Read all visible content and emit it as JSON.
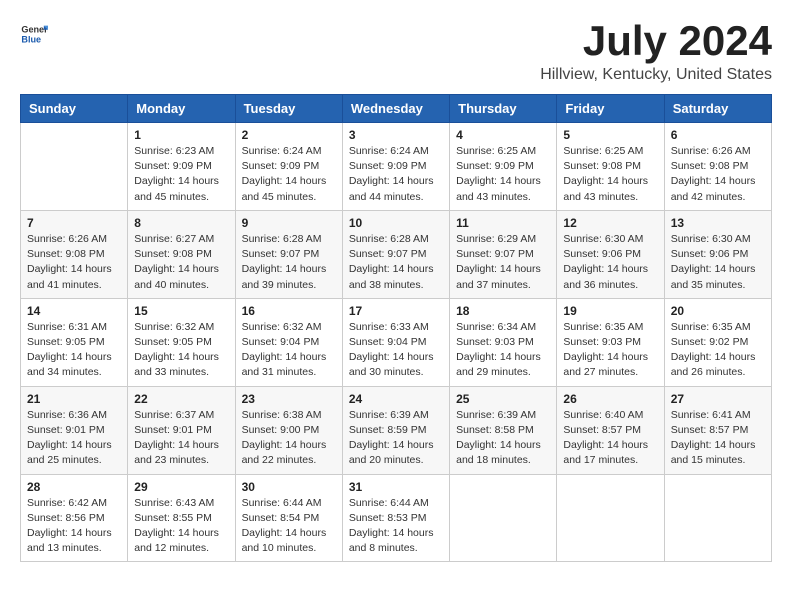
{
  "header": {
    "logo_general": "General",
    "logo_blue": "Blue",
    "title": "July 2024",
    "subtitle": "Hillview, Kentucky, United States"
  },
  "columns": [
    "Sunday",
    "Monday",
    "Tuesday",
    "Wednesday",
    "Thursday",
    "Friday",
    "Saturday"
  ],
  "weeks": [
    [
      {
        "day": "",
        "sunrise": "",
        "sunset": "",
        "daylight": ""
      },
      {
        "day": "1",
        "sunrise": "Sunrise: 6:23 AM",
        "sunset": "Sunset: 9:09 PM",
        "daylight": "Daylight: 14 hours and 45 minutes."
      },
      {
        "day": "2",
        "sunrise": "Sunrise: 6:24 AM",
        "sunset": "Sunset: 9:09 PM",
        "daylight": "Daylight: 14 hours and 45 minutes."
      },
      {
        "day": "3",
        "sunrise": "Sunrise: 6:24 AM",
        "sunset": "Sunset: 9:09 PM",
        "daylight": "Daylight: 14 hours and 44 minutes."
      },
      {
        "day": "4",
        "sunrise": "Sunrise: 6:25 AM",
        "sunset": "Sunset: 9:09 PM",
        "daylight": "Daylight: 14 hours and 43 minutes."
      },
      {
        "day": "5",
        "sunrise": "Sunrise: 6:25 AM",
        "sunset": "Sunset: 9:08 PM",
        "daylight": "Daylight: 14 hours and 43 minutes."
      },
      {
        "day": "6",
        "sunrise": "Sunrise: 6:26 AM",
        "sunset": "Sunset: 9:08 PM",
        "daylight": "Daylight: 14 hours and 42 minutes."
      }
    ],
    [
      {
        "day": "7",
        "sunrise": "Sunrise: 6:26 AM",
        "sunset": "Sunset: 9:08 PM",
        "daylight": "Daylight: 14 hours and 41 minutes."
      },
      {
        "day": "8",
        "sunrise": "Sunrise: 6:27 AM",
        "sunset": "Sunset: 9:08 PM",
        "daylight": "Daylight: 14 hours and 40 minutes."
      },
      {
        "day": "9",
        "sunrise": "Sunrise: 6:28 AM",
        "sunset": "Sunset: 9:07 PM",
        "daylight": "Daylight: 14 hours and 39 minutes."
      },
      {
        "day": "10",
        "sunrise": "Sunrise: 6:28 AM",
        "sunset": "Sunset: 9:07 PM",
        "daylight": "Daylight: 14 hours and 38 minutes."
      },
      {
        "day": "11",
        "sunrise": "Sunrise: 6:29 AM",
        "sunset": "Sunset: 9:07 PM",
        "daylight": "Daylight: 14 hours and 37 minutes."
      },
      {
        "day": "12",
        "sunrise": "Sunrise: 6:30 AM",
        "sunset": "Sunset: 9:06 PM",
        "daylight": "Daylight: 14 hours and 36 minutes."
      },
      {
        "day": "13",
        "sunrise": "Sunrise: 6:30 AM",
        "sunset": "Sunset: 9:06 PM",
        "daylight": "Daylight: 14 hours and 35 minutes."
      }
    ],
    [
      {
        "day": "14",
        "sunrise": "Sunrise: 6:31 AM",
        "sunset": "Sunset: 9:05 PM",
        "daylight": "Daylight: 14 hours and 34 minutes."
      },
      {
        "day": "15",
        "sunrise": "Sunrise: 6:32 AM",
        "sunset": "Sunset: 9:05 PM",
        "daylight": "Daylight: 14 hours and 33 minutes."
      },
      {
        "day": "16",
        "sunrise": "Sunrise: 6:32 AM",
        "sunset": "Sunset: 9:04 PM",
        "daylight": "Daylight: 14 hours and 31 minutes."
      },
      {
        "day": "17",
        "sunrise": "Sunrise: 6:33 AM",
        "sunset": "Sunset: 9:04 PM",
        "daylight": "Daylight: 14 hours and 30 minutes."
      },
      {
        "day": "18",
        "sunrise": "Sunrise: 6:34 AM",
        "sunset": "Sunset: 9:03 PM",
        "daylight": "Daylight: 14 hours and 29 minutes."
      },
      {
        "day": "19",
        "sunrise": "Sunrise: 6:35 AM",
        "sunset": "Sunset: 9:03 PM",
        "daylight": "Daylight: 14 hours and 27 minutes."
      },
      {
        "day": "20",
        "sunrise": "Sunrise: 6:35 AM",
        "sunset": "Sunset: 9:02 PM",
        "daylight": "Daylight: 14 hours and 26 minutes."
      }
    ],
    [
      {
        "day": "21",
        "sunrise": "Sunrise: 6:36 AM",
        "sunset": "Sunset: 9:01 PM",
        "daylight": "Daylight: 14 hours and 25 minutes."
      },
      {
        "day": "22",
        "sunrise": "Sunrise: 6:37 AM",
        "sunset": "Sunset: 9:01 PM",
        "daylight": "Daylight: 14 hours and 23 minutes."
      },
      {
        "day": "23",
        "sunrise": "Sunrise: 6:38 AM",
        "sunset": "Sunset: 9:00 PM",
        "daylight": "Daylight: 14 hours and 22 minutes."
      },
      {
        "day": "24",
        "sunrise": "Sunrise: 6:39 AM",
        "sunset": "Sunset: 8:59 PM",
        "daylight": "Daylight: 14 hours and 20 minutes."
      },
      {
        "day": "25",
        "sunrise": "Sunrise: 6:39 AM",
        "sunset": "Sunset: 8:58 PM",
        "daylight": "Daylight: 14 hours and 18 minutes."
      },
      {
        "day": "26",
        "sunrise": "Sunrise: 6:40 AM",
        "sunset": "Sunset: 8:57 PM",
        "daylight": "Daylight: 14 hours and 17 minutes."
      },
      {
        "day": "27",
        "sunrise": "Sunrise: 6:41 AM",
        "sunset": "Sunset: 8:57 PM",
        "daylight": "Daylight: 14 hours and 15 minutes."
      }
    ],
    [
      {
        "day": "28",
        "sunrise": "Sunrise: 6:42 AM",
        "sunset": "Sunset: 8:56 PM",
        "daylight": "Daylight: 14 hours and 13 minutes."
      },
      {
        "day": "29",
        "sunrise": "Sunrise: 6:43 AM",
        "sunset": "Sunset: 8:55 PM",
        "daylight": "Daylight: 14 hours and 12 minutes."
      },
      {
        "day": "30",
        "sunrise": "Sunrise: 6:44 AM",
        "sunset": "Sunset: 8:54 PM",
        "daylight": "Daylight: 14 hours and 10 minutes."
      },
      {
        "day": "31",
        "sunrise": "Sunrise: 6:44 AM",
        "sunset": "Sunset: 8:53 PM",
        "daylight": "Daylight: 14 hours and 8 minutes."
      },
      {
        "day": "",
        "sunrise": "",
        "sunset": "",
        "daylight": ""
      },
      {
        "day": "",
        "sunrise": "",
        "sunset": "",
        "daylight": ""
      },
      {
        "day": "",
        "sunrise": "",
        "sunset": "",
        "daylight": ""
      }
    ]
  ]
}
